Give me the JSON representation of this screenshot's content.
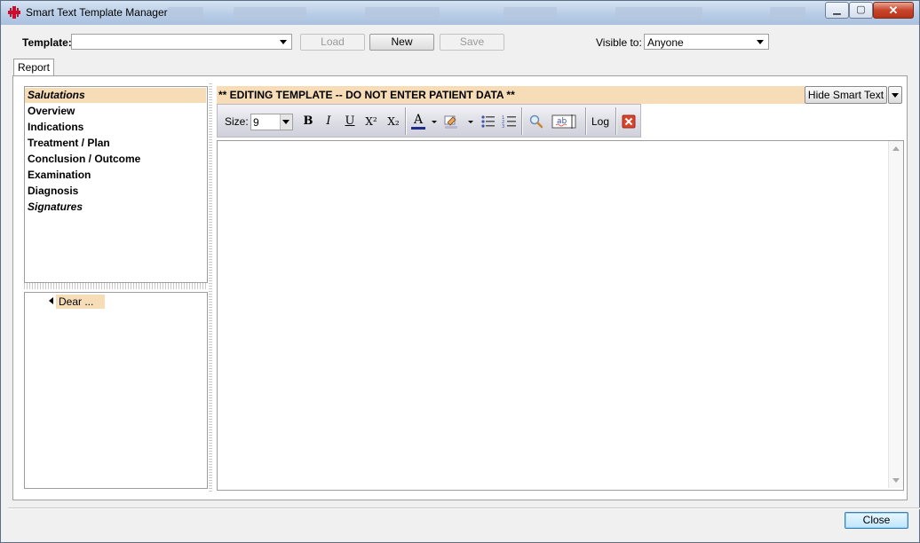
{
  "window": {
    "title": "Smart Text Template Manager",
    "minimize_glyph": "▁",
    "maximize_glyph": "▢",
    "close_glyph": "✕"
  },
  "header": {
    "template_label": "Template:",
    "template_value": "",
    "load_label": "Load",
    "new_label": "New",
    "save_label": "Save",
    "visible_to_label": "Visible to:",
    "visible_to_value": "Anyone"
  },
  "tabs": [
    {
      "label": "Report"
    }
  ],
  "sections": {
    "items": [
      {
        "label": "Salutations",
        "italic": true,
        "selected": true
      },
      {
        "label": "Overview",
        "italic": false
      },
      {
        "label": "Indications",
        "italic": false
      },
      {
        "label": "Treatment / Plan",
        "italic": false
      },
      {
        "label": "Conclusion / Outcome",
        "italic": false
      },
      {
        "label": "Examination",
        "italic": false
      },
      {
        "label": "Diagnosis",
        "italic": false
      },
      {
        "label": "Signatures",
        "italic": true
      }
    ]
  },
  "phrases": {
    "items": [
      {
        "label": "Dear ..."
      }
    ]
  },
  "editor": {
    "banner": "** EDITING TEMPLATE -- DO NOT ENTER PATIENT DATA **",
    "hide_smart_text_label": "Hide Smart Text",
    "content": ""
  },
  "toolbar": {
    "size_label": "Size:",
    "size_value": "9",
    "bold_glyph": "B",
    "italic_glyph": "I",
    "underline_glyph": "U",
    "superscript_glyph": "X²",
    "subscript_glyph": "X₂",
    "font_color_glyph": "A",
    "log_label": "Log"
  },
  "footer": {
    "close_label": "Close"
  },
  "colors": {
    "accent_highlight": "#f6dcb7",
    "titlebar": "#b8cde6",
    "close_red": "#d9442b"
  }
}
